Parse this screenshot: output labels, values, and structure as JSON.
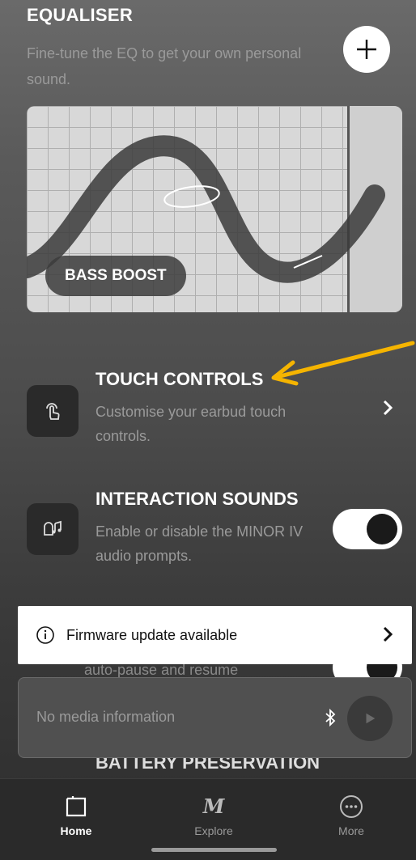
{
  "equaliser": {
    "title": "EQUALISER",
    "description": "Fine-tune the EQ to get your own personal sound.",
    "preset": "BASS BOOST"
  },
  "touch_controls": {
    "title": "TOUCH CONTROLS",
    "description": "Customise your earbud touch controls."
  },
  "interaction_sounds": {
    "title": "INTERACTION SOUNDS",
    "description": "Enable or disable the MINOR IV audio prompts.",
    "enabled": true
  },
  "obscured_setting": {
    "description_fragment": "auto-pause and resume"
  },
  "battery_preservation": {
    "title": "BATTERY PRESERVATION"
  },
  "firmware_banner": {
    "text": "Firmware update available"
  },
  "player": {
    "text": "No media information"
  },
  "tabs": [
    {
      "label": "Home",
      "icon": "home-icon",
      "active": true
    },
    {
      "label": "Explore",
      "icon": "marshall-m-icon",
      "active": false
    },
    {
      "label": "More",
      "icon": "more-icon",
      "active": false
    }
  ],
  "colors": {
    "annotation_arrow": "#f5b400",
    "toggle_on": "#ffffff"
  }
}
